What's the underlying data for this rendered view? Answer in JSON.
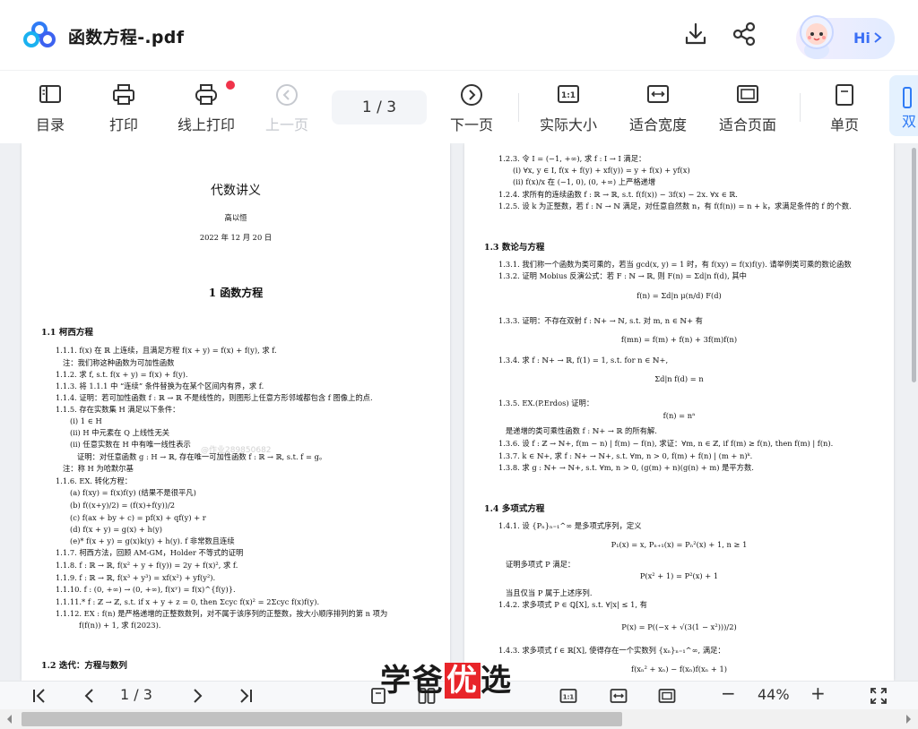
{
  "header": {
    "title": "函数方程-.pdf",
    "hi_label": "Hi",
    "icons": [
      "download-icon",
      "share-icon",
      "chevron-right-icon"
    ]
  },
  "toolbar": {
    "items": [
      {
        "label": "目录",
        "icon": "toc-icon"
      },
      {
        "label": "打印",
        "icon": "printer-icon"
      },
      {
        "label": "线上打印",
        "icon": "online-print-icon"
      },
      {
        "label": "上一页",
        "icon": "prev-page-icon",
        "disabled": true
      },
      {
        "label": "下一页",
        "icon": "next-page-icon"
      },
      {
        "label": "实际大小",
        "icon": "actual-size-icon"
      },
      {
        "label": "适合宽度",
        "icon": "fit-width-icon"
      },
      {
        "label": "适合页面",
        "icon": "fit-page-icon"
      },
      {
        "label": "单页",
        "icon": "single-page-icon"
      },
      {
        "label": "双",
        "icon": "double-page-icon",
        "active": true
      }
    ],
    "page_indicator": "1 / 3"
  },
  "document": {
    "left_page": {
      "title": "代数讲义",
      "author": "高以恒",
      "date": "2022 年 12 月 20 日",
      "chapter": "1 函数方程",
      "section1": "1.1 柯西方程",
      "lines": [
        "1.1.1. f(x) 在 ℝ 上连续，且满足方程 f(x + y) = f(x) + f(y), 求 f.",
        "注：我们称这种函数为可加性函数",
        "1.1.2. 求 f, s.t. f(x + y) = f(x) + f(y).",
        "1.1.3. 将 1.1.1 中 “连续” 条件替换为在某个区间内有界，求 f.",
        "1.1.4. 证明：若可加性函数 f : ℝ → ℝ 不是线性的，则图形上任意方形邻域都包含 f 图像上的点.",
        "1.1.5. 存在实数集 H 满足以下条件：",
        "(i) 1 ∈ H",
        "(ii) H 中元素在 Q 上线性无关",
        "(ii) 任意实数在 H 中有唯一线性表示",
        "证明：对任意函数 g : H → ℝ, 存在唯一可加性函数 f : ℝ → ℝ, s.t. f = g。",
        "注：称 H 为哈默尔基",
        "1.1.6. EX. 转化方程：",
        "(a) f(xy) = f(x)f(y) (结果不是很平凡)",
        "(b) f((x+y)/2) = (f(x)+f(y))/2",
        "(c) f(ax + by + c) = pf(x) + qf(y) + r",
        "(d) f(x + y) = g(x) + h(y)",
        "(e)* f(x + y) = g(x)k(y) + h(y). f 非常数且连续",
        "1.1.7. 柯西方法，回顾 AM-GM，Holder 不等式的证明",
        "1.1.8. f : ℝ → ℝ, f(x² + y + f(y)) = 2y + f(x)², 求 f.",
        "1.1.9. f : ℝ → ℝ, f(x³ + y³) = xf(x²) + yf(y²).",
        "1.1.10. f : (0, +∞) → (0, +∞), f(xʸ) = f(x)^{f(y)}.",
        "1.1.11.* f : ℤ → ℤ, s.t. if x + y + z = 0, then Σcyc f(x)² = 2Σcyc f(x)f(y).",
        "1.1.12. EX : f(n) 是严格递增的正整数数列，对不属于该序列的正整数，按大小顺序排列的第 n 项为",
        "f(f(n)) + 1, 求 f(2023)."
      ],
      "section2": "1.2 迭代：方程与数列",
      "faint_watermark": "@作业289850682"
    },
    "right_page": {
      "lines_top": [
        "1.2.3. 令 I = (−1, +∞), 求 f : I → I 满足：",
        "(i) ∀x, y ∈ I, f(x + f(y) + xf(y)) = y + f(x) + yf(x)",
        "(ii) f(x)/x 在 (−1, 0), (0, +∞) 上严格递增",
        "1.2.4. 求所有的连续函数 f : ℝ → ℝ, s.t. f(f(x)) − 3f(x) − 2x. ∀x ∈ ℝ.",
        "1.2.5. 设 k 为正整数，若 f : ℕ → ℕ 满足，对任意自然数 n，有 f(f(n)) = n + k，求满足条件的 f 的个数."
      ],
      "section3": "1.3 数论与方程",
      "lines_mid": [
        "1.3.1. 我们称一个函数为类可乘的，若当 gcd(x, y) = 1 时，有 f(xy) = f(x)f(y). 请举例类可乘的数论函数",
        "1.3.2. 证明 Mobius 反演公式：若 F : ℕ → ℝ, 则 F(n) = Σd|n f(d), 其中",
        "f(n) = Σd|n μ(n/d) F(d)",
        "1.3.3. 证明：不存在双射 f : ℕ+ → ℕ, s.t. 对 m, n ∈ ℕ+ 有",
        "f(mn) = f(m) + f(n) + 3f(m)f(n)",
        "1.3.4. 求 f : ℕ+ → ℝ, f(1) = 1, s.t. for n ∈ ℕ+,",
        "Σd|n f(d) = n",
        "1.3.5. EX.(P.Erdos) 证明：",
        "f(n) = nᵃ",
        "是递增的类可乘性函数 f : ℕ+ → ℝ 的所有解.",
        "1.3.6. 设 f : ℤ → ℕ+, f(m − n) | f(m) − f(n), 求证：∀m, n ∈ ℤ, if f(m) ≥ f(n), then f(m) | f(n).",
        "1.3.7. k ∈ ℕ+, 求 f : ℕ+ → ℕ+, s.t. ∀m, n > 0, f(m) + f(n) | (m + n)ᵏ.",
        "1.3.8. 求 g : ℕ+ → ℕ+, s.t. ∀m, n > 0, (g(m) + n)(g(n) + m) 是平方数."
      ],
      "section4": "1.4 多项式方程",
      "lines_bottom": [
        "1.4.1. 设 {Pₙ}ₙ₌₁^∞ 是多项式序列，定义",
        "P₁(x) = x, Pₙ₊₁(x) = Pₙ²(x) + 1, n ≥ 1",
        "证明多项式 P 满足：",
        "P(x² + 1) = P²(x) + 1",
        "当且仅当 P 属于上述序列.",
        "1.4.2. 求多项式 P ∈ ℚ[X], s.t. ∀|x| ≤ 1, 有",
        "P(x) = P((−x + √(3(1 − x²)))/2)",
        "1.4.3. 求多项式 f ∈ ℝ[X], 使得存在一个实数列 {xₙ}ₙ₌₁^∞, 满足：",
        "f(xₙ² + xₙ) − f(xₙ)f(xₙ + 1)"
      ]
    }
  },
  "brand_watermark": {
    "part1": "学爸",
    "part2": "优",
    "part3": "选"
  },
  "bottombar": {
    "page_indicator": "1 / 3",
    "zoom": "44%",
    "minus": "−",
    "plus": "+"
  },
  "colors": {
    "accent": "#3b6ff5",
    "red_dot": "#f0334a",
    "active_bg": "#e4f1fe",
    "viewer_bg": "#eef0f3"
  }
}
